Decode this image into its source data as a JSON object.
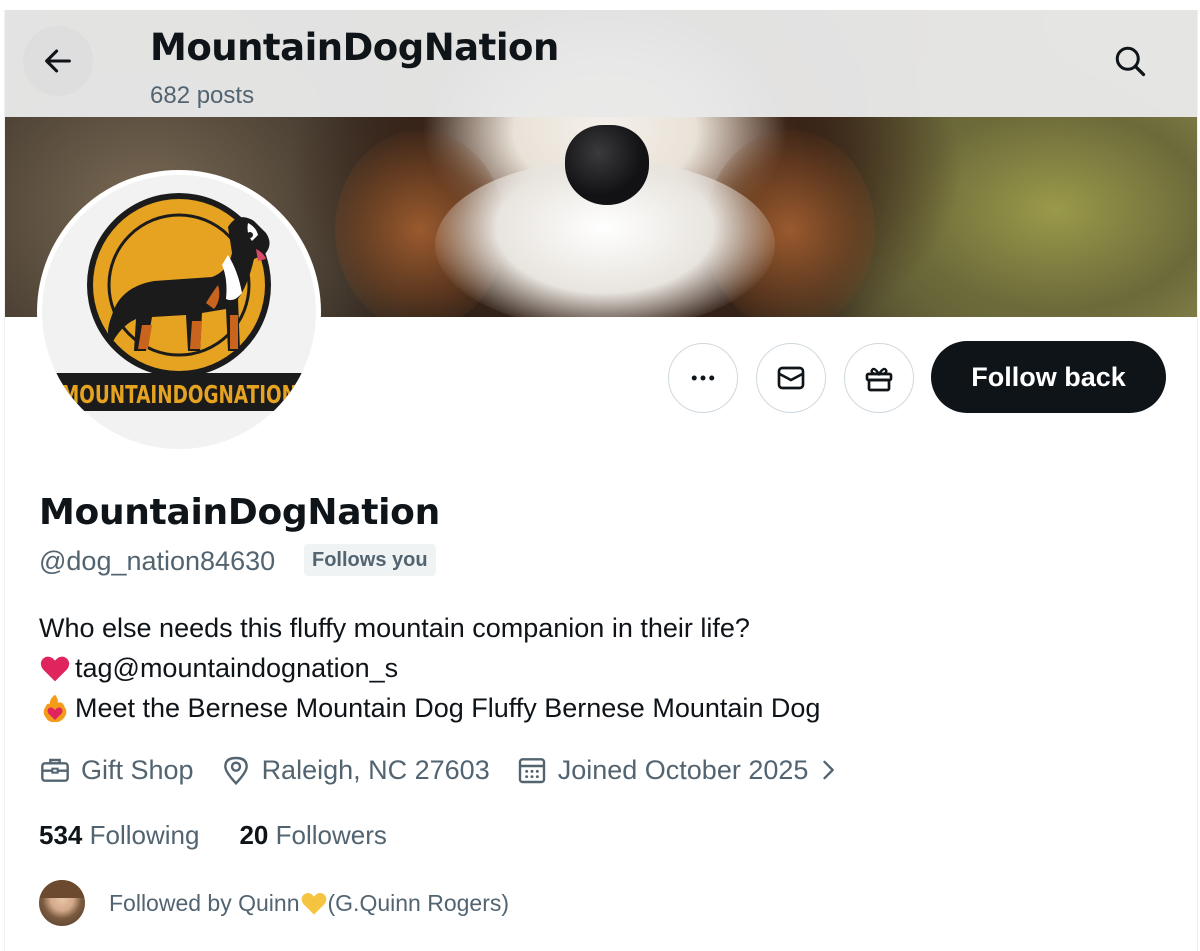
{
  "header": {
    "title": "MountainDogNation",
    "posts": "682 posts"
  },
  "avatar": {
    "logo_text": "MOUNTAINDOGNATION"
  },
  "actions": {
    "follow_label": "Follow back"
  },
  "profile": {
    "display_name": "MountainDogNation",
    "handle": "@dog_nation84630",
    "follows_you": "Follows you",
    "bio": [
      "Who else needs this fluffy mountain companion in their life?",
      "tag@mountaindognation_s",
      " Meet the Bernese Mountain Dog Fluffy Bernese Mountain Dog"
    ]
  },
  "meta": {
    "category": "Gift Shop",
    "location": "Raleigh, NC 27603",
    "joined": "Joined October 2025"
  },
  "stats": {
    "following_count": "534",
    "following_label": "Following",
    "followers_count": "20",
    "followers_label": "Followers"
  },
  "followed_by": {
    "prefix": "Followed by Quinn ",
    "suffix": "(G.Quinn Rogers)"
  },
  "colors": {
    "text_primary": "#0f1419",
    "text_secondary": "#536471",
    "logo_orange": "#e5a321",
    "heart_red": "#e0245e"
  }
}
